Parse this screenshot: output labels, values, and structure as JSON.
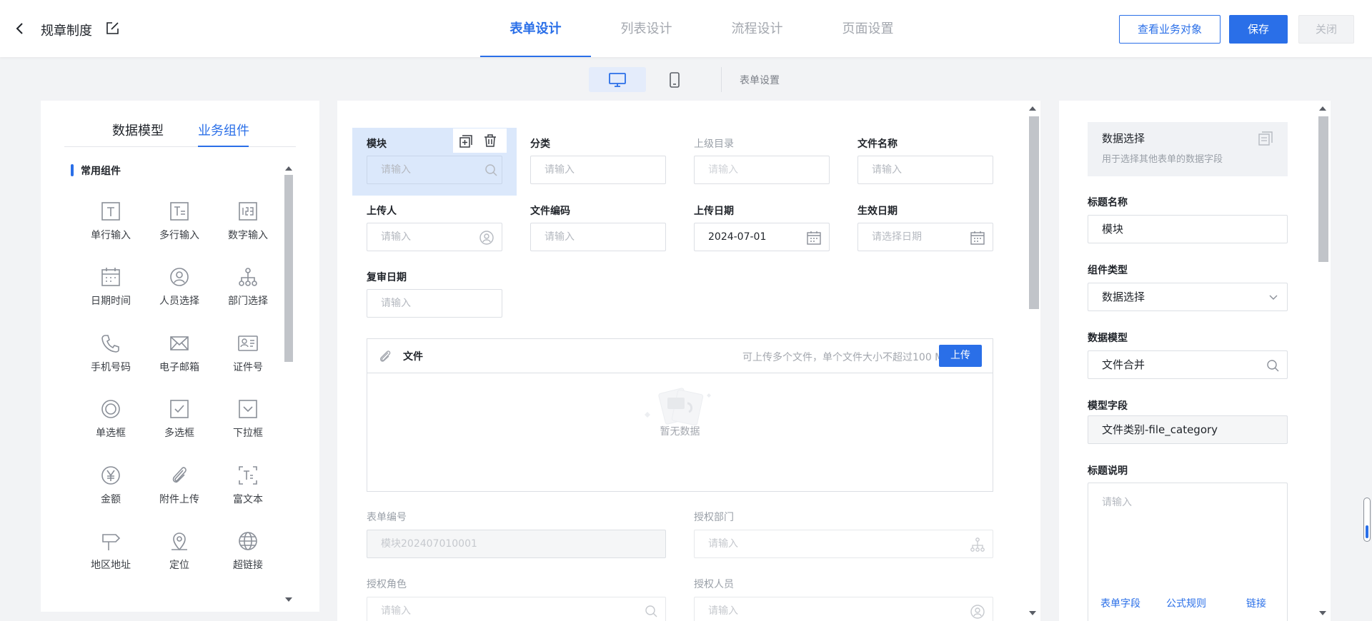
{
  "header": {
    "title": "规章制度",
    "tabs": [
      "表单设计",
      "列表设计",
      "流程设计",
      "页面设置"
    ],
    "buttons": {
      "view_business_object": "查看业务对象",
      "save": "保存",
      "close": "关闭"
    }
  },
  "toolbar": {
    "form_settings": "表单设置"
  },
  "left_panel": {
    "tabs": [
      "数据模型",
      "业务组件"
    ],
    "active_tab": "业务组件",
    "section_title": "常用组件",
    "components": [
      {
        "label": "单行输入",
        "icon": "text-icon"
      },
      {
        "label": "多行输入",
        "icon": "multiline-text-icon"
      },
      {
        "label": "数字输入",
        "icon": "number-icon"
      },
      {
        "label": "日期时间",
        "icon": "calendar-icon"
      },
      {
        "label": "人员选择",
        "icon": "person-icon"
      },
      {
        "label": "部门选择",
        "icon": "org-tree-icon"
      },
      {
        "label": "手机号码",
        "icon": "phone-icon"
      },
      {
        "label": "电子邮箱",
        "icon": "mail-icon"
      },
      {
        "label": "证件号",
        "icon": "id-card-icon"
      },
      {
        "label": "单选框",
        "icon": "radio-icon"
      },
      {
        "label": "多选框",
        "icon": "checkbox-icon"
      },
      {
        "label": "下拉框",
        "icon": "dropdown-icon"
      },
      {
        "label": "金额",
        "icon": "yen-icon"
      },
      {
        "label": "附件上传",
        "icon": "paperclip-icon"
      },
      {
        "label": "富文本",
        "icon": "rich-text-icon"
      },
      {
        "label": "地区地址",
        "icon": "signpost-icon"
      },
      {
        "label": "定位",
        "icon": "location-pin-icon"
      },
      {
        "label": "超链接",
        "icon": "globe-icon"
      }
    ]
  },
  "form": {
    "fields": [
      {
        "label": "模块",
        "placeholder": "请输入",
        "icon": "search-icon"
      },
      {
        "label": "分类",
        "placeholder": "请输入"
      },
      {
        "label": "上级目录",
        "placeholder": "请输入"
      },
      {
        "label": "文件名称",
        "placeholder": "请输入"
      },
      {
        "label": "上传人",
        "placeholder": "请输入",
        "icon": "person-icon"
      },
      {
        "label": "文件编码",
        "placeholder": "请输入"
      },
      {
        "label": "上传日期",
        "value": "2024-07-01",
        "icon": "calendar-icon"
      },
      {
        "label": "生效日期",
        "placeholder": "请选择日期",
        "icon": "calendar-icon"
      },
      {
        "label": "复审日期",
        "placeholder": "请输入"
      }
    ],
    "upload": {
      "title": "文件",
      "hint": "可上传多个文件，单个文件大小不超过100 M",
      "button": "上传",
      "empty": "暂无数据"
    },
    "system_fields": [
      {
        "label": "表单编号",
        "value": "模块202407010001"
      },
      {
        "label": "授权部门",
        "placeholder": "请输入",
        "icon": "org-tree-icon"
      },
      {
        "label": "授权角色",
        "placeholder": "请输入",
        "icon": "search-icon"
      },
      {
        "label": "授权人员",
        "placeholder": "请输入",
        "icon": "person-icon"
      }
    ]
  },
  "properties": {
    "card_title": "数据选择",
    "card_desc": "用于选择其他表单的数据字段",
    "title_name_label": "标题名称",
    "title_name_value": "模块",
    "component_type_label": "组件类型",
    "component_type_value": "数据选择",
    "data_model_label": "数据模型",
    "data_model_value": "文件合并",
    "model_field_label": "模型字段",
    "model_field_value": "文件类别-file_category",
    "title_desc_label": "标题说明",
    "title_desc_placeholder": "请输入",
    "links": [
      "表单字段",
      "公式规则",
      "链接"
    ]
  },
  "colors": {
    "accent": "#2a6fe8",
    "selected_bg": "#dbe8fb"
  }
}
